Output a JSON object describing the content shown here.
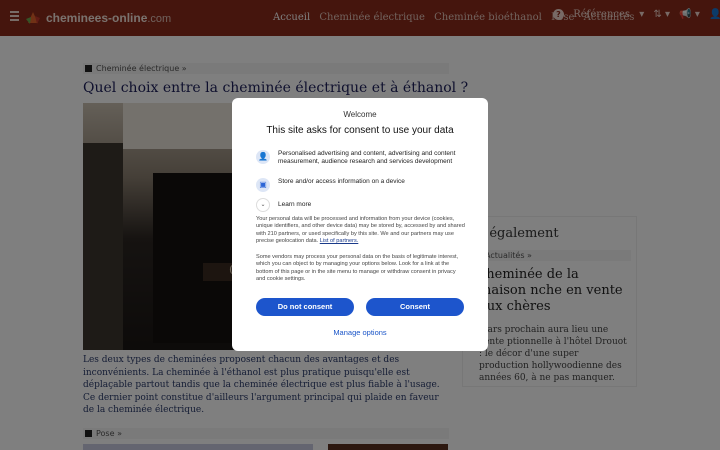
{
  "header": {
    "logo": "cheminees-online",
    "logo_tld": ".com",
    "nav": [
      "Accueil",
      "Cheminée électrique",
      "Cheminée bioéthanol",
      "Pose",
      "Actualités"
    ],
    "references": "Références"
  },
  "article": {
    "breadcrumb": "Cheminée électrique »",
    "title": "Quel choix entre la cheminée électrique et à éthanol ?",
    "description": "Les deux types de cheminées proposent chacun des avantages et des inconvénients. La cheminée à l'éthanol est plus pratique puisqu'elle est déplaçable partout tandis que la cheminée électrique est plus fiable à l'usage. Ce dernier point constitue d'ailleurs l'argument principal qui plaide en faveur de la cheminée électrique."
  },
  "article2": {
    "breadcrumb": "Pose »"
  },
  "sidebar": {
    "title": "r également",
    "breadcrumb": "Actualités »",
    "headline": "cheminée de la maison nche en vente aux chères",
    "text": "mars prochain aura lieu une vente ptionnelle à l'hôtel Drouot : le décor d'une super production hollywoodienne des années 60, à ne pas manquer."
  },
  "consent": {
    "welcome": "Welcome",
    "title": "This site asks for consent to use your data",
    "option1": "Personalised advertising and content, advertising and content measurement, audience research and services development",
    "option2": "Store and/or access information on a device",
    "learn_more": "Learn more",
    "body1": "Your personal data will be processed and information from your device (cookies, unique identifiers, and other device data) may be stored by, accessed by and shared with 210 partners, or used specifically by this site. We and our partners may use precise geolocation data.",
    "partners_link": "List of partners.",
    "body2": "Some vendors may process your personal data on the basis of legitimate interest, which you can object to by managing your options below. Look for a link at the bottom of this page or in the site menu to manage or withdraw consent in privacy and cookie settings.",
    "do_not_consent": "Do not consent",
    "consent_btn": "Consent",
    "manage_options": "Manage options"
  },
  "colors": {
    "header_bg": "#8b2a1a",
    "title_color": "#1d1f5a",
    "button_blue": "#1d55cc"
  }
}
